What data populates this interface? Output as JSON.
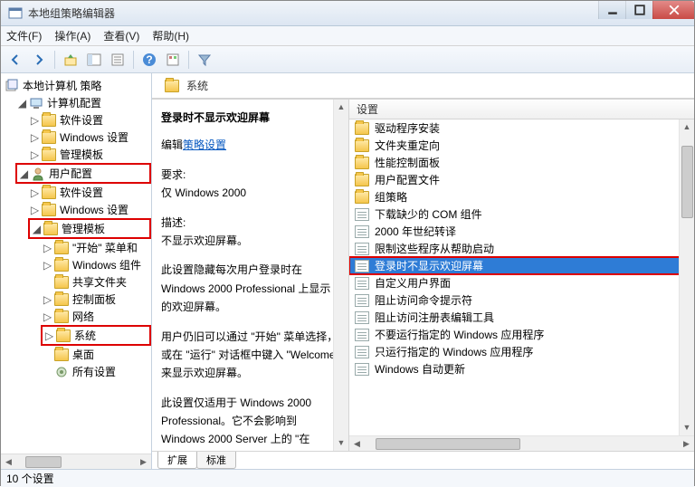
{
  "window": {
    "title": "本地组策略编辑器"
  },
  "menu": {
    "file": "文件(F)",
    "action": "操作(A)",
    "view": "查看(V)",
    "help": "帮助(H)"
  },
  "tree": {
    "root": "本地计算机 策略",
    "computer": "计算机配置",
    "computer_children": {
      "software": "软件设置",
      "windows": "Windows 设置",
      "admin": "管理模板"
    },
    "user": "用户配置",
    "user_children": {
      "software": "软件设置",
      "windows": "Windows 设置",
      "admin": "管理模板",
      "admin_children": {
        "start": "\"开始\" 菜单和",
        "win_comp": "Windows 组件",
        "shared": "共享文件夹",
        "control": "控制面板",
        "network": "网络",
        "system": "系统",
        "desktop": "桌面",
        "all": "所有设置"
      }
    }
  },
  "header": {
    "title": "系统"
  },
  "description": {
    "title": "登录时不显示欢迎屏幕",
    "edit_label": "编辑",
    "policy_link": "策略设置",
    "req_label": "要求:",
    "req_value": "仅 Windows 2000",
    "desc_label": "描述:",
    "desc_line1": "不显示欢迎屏幕。",
    "para2": "此设置隐藏每次用户登录时在 Windows 2000 Professional 上显示的欢迎屏幕。",
    "para3": "用户仍旧可以通过 \"开始\" 菜单选择，或在 \"运行\" 对话框中键入 \"Welcome\" 来显示欢迎屏幕。",
    "para4": "此设置仅适用于 Windows 2000 Professional。它不会影响到 Windows 2000 Server 上的 \"在"
  },
  "list": {
    "header": "设置",
    "items": [
      {
        "type": "folder",
        "label": "驱动程序安装"
      },
      {
        "type": "folder",
        "label": "文件夹重定向"
      },
      {
        "type": "folder",
        "label": "性能控制面板"
      },
      {
        "type": "folder",
        "label": "用户配置文件"
      },
      {
        "type": "folder",
        "label": "组策略"
      },
      {
        "type": "setting",
        "label": "下载缺少的 COM 组件"
      },
      {
        "type": "setting",
        "label": "2000 年世纪转译"
      },
      {
        "type": "setting",
        "label": "限制这些程序从帮助启动"
      },
      {
        "type": "setting",
        "label": "登录时不显示欢迎屏幕",
        "selected": true
      },
      {
        "type": "setting",
        "label": "自定义用户界面"
      },
      {
        "type": "setting",
        "label": "阻止访问命令提示符"
      },
      {
        "type": "setting",
        "label": "阻止访问注册表编辑工具"
      },
      {
        "type": "setting",
        "label": "不要运行指定的 Windows 应用程序"
      },
      {
        "type": "setting",
        "label": "只运行指定的 Windows 应用程序"
      },
      {
        "type": "setting",
        "label": "Windows 自动更新"
      }
    ]
  },
  "tabs": {
    "extended": "扩展",
    "standard": "标准"
  },
  "status": {
    "text": "10 个设置"
  }
}
